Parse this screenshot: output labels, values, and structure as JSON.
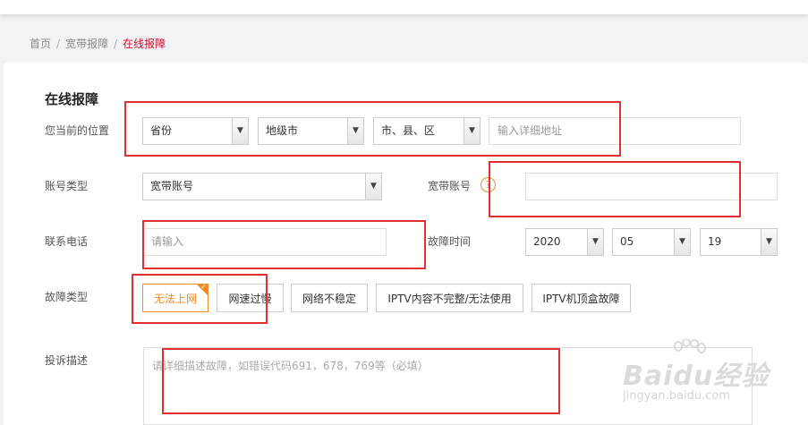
{
  "breadcrumb": {
    "home": "首页",
    "sep": "/",
    "section": "宽带报障",
    "current": "在线报障"
  },
  "form": {
    "title": "在线报障",
    "location": {
      "label": "您当前的位置",
      "province": "省份",
      "city": "地级市",
      "county": "市、县、区",
      "address_placeholder": "输入详细地址"
    },
    "account_type": {
      "label": "账号类型",
      "value": "宽带账号"
    },
    "broadband_account": {
      "label": "宽带账号",
      "help": "?"
    },
    "phone": {
      "label": "联系电话",
      "placeholder": "请输入"
    },
    "fault_time": {
      "label": "故障时间",
      "year": "2020",
      "month": "05",
      "day": "19"
    },
    "fault_type": {
      "label": "故障类型",
      "options": [
        "无法上网",
        "网速过慢",
        "网络不稳定",
        "IPTV内容不完整/无法使用",
        "IPTV机顶盒故障"
      ],
      "selected_index": 0
    },
    "description": {
      "label": "投诉描述",
      "placeholder": "请详细描述故障，如错误代码691，678，769等（必填）"
    }
  },
  "watermark": {
    "main": "Baidu经验",
    "sub": "jingyan.baidu.com"
  },
  "colors": {
    "accent": "#c8102e",
    "selected": "#f08a24",
    "annotation": "#e03030"
  }
}
